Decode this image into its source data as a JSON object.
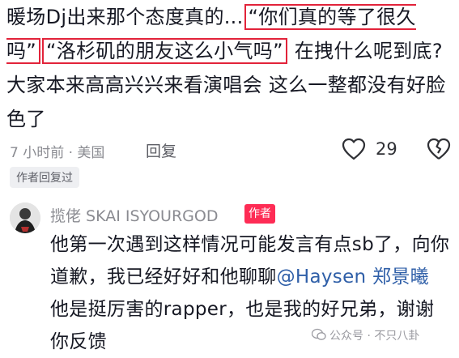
{
  "comment": {
    "part1": "暖场Dj出来那个态度真的...",
    "quote1": "“你们真的等了很久吗”",
    "quote2": "“洛杉矶的朋友这么小气吗”",
    "part2": " 在拽什么呢到底? 大家本来高高兴兴来看演唱会 这么一整都没有好脸色了",
    "time_location": "7 小时前 · 美国",
    "reply_label": "回复",
    "like_count": "29",
    "author_replied_tag": "作者回复过"
  },
  "reply": {
    "username": "揽佬 SKAI ISYOURGOD",
    "author_badge": "作者",
    "text1": "他第一次遇到这样情况可能发言有点sb了，向你道歉，我已经好好和他聊聊",
    "mention": "@Haysen 郑景曦",
    "text2": " 他是挺厉害的rapper，也是我的好兄弟，谢谢你反馈"
  },
  "watermark": {
    "text": "公众号 · 不只八卦"
  },
  "colors": {
    "highlight_box": "#e2233a",
    "mention": "#2f5fa8",
    "author_badge": "#fe2c55"
  }
}
